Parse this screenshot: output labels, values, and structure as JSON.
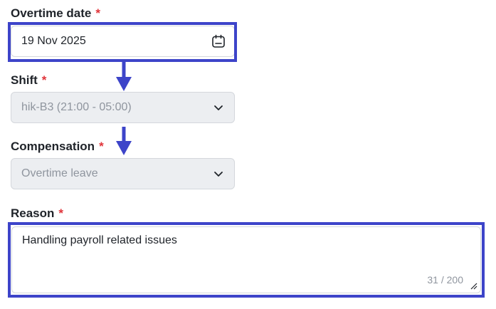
{
  "form": {
    "overtime_date": {
      "label": "Overtime date",
      "required_mark": "*",
      "value": "19 Nov 2025",
      "icon": "calendar-icon"
    },
    "shift": {
      "label": "Shift",
      "required_mark": "*",
      "value": "hik-B3 (21:00 - 05:00)",
      "icon": "chevron-down-icon"
    },
    "compensation": {
      "label": "Compensation",
      "required_mark": "*",
      "value": "Overtime leave",
      "icon": "chevron-down-icon"
    },
    "reason": {
      "label": "Reason",
      "required_mark": "*",
      "value": "Handling payroll related issues",
      "counter": "31 / 200"
    }
  },
  "colors": {
    "annotation": "#3d44c9",
    "required": "#e0343a",
    "disabled_bg": "#eceef1"
  }
}
